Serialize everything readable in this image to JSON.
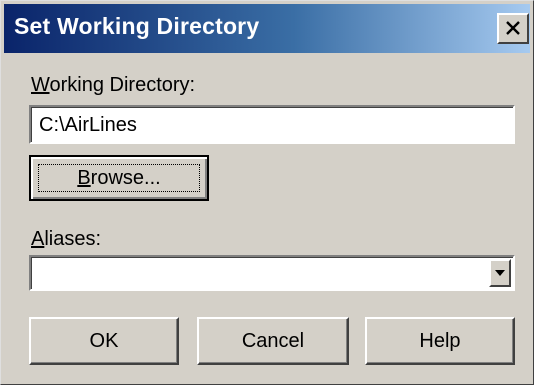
{
  "window": {
    "title": "Set Working Directory",
    "close_label": "close"
  },
  "working_directory": {
    "label_key": "W",
    "label_rest": "orking Directory:",
    "value": "C:\\AirLines"
  },
  "browse_button": {
    "label_key": "B",
    "label_rest": "rowse..."
  },
  "aliases": {
    "label_key": "A",
    "label_rest": "liases:",
    "value": ""
  },
  "buttons": {
    "ok": "OK",
    "cancel": "Cancel",
    "help": "Help"
  },
  "icons": {
    "close": "close-icon",
    "dropdown": "chevron-down-icon"
  },
  "colors": {
    "titlebar_start": "#0a246a",
    "titlebar_end": "#a6caf0",
    "dialog_face": "#d4d0c8"
  }
}
